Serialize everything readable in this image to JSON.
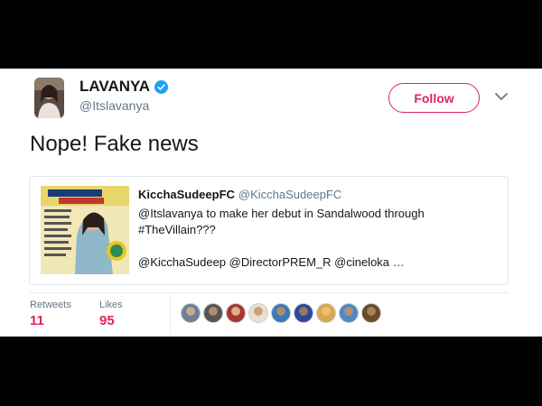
{
  "tweet": {
    "author": {
      "name": "LAVANYA",
      "handle": "@Itslavanya",
      "verified": true
    },
    "follow_label": "Follow",
    "text": "Nope! Fake news",
    "quote": {
      "author_name": "KicchaSudeepFC",
      "author_handle": "@KicchaSudeepFC",
      "line1": "@Itslavanya to make her debut in Sandalwood through",
      "line2": "#TheVillain???",
      "line3": "@KicchaSudeep @DirectorPREM_R @cineloka …"
    },
    "stats": {
      "retweets_label": "Retweets",
      "retweets": "11",
      "likes_label": "Likes",
      "likes": "95"
    }
  },
  "colors": {
    "accent": "#e0245e",
    "verified": "#1da1f2",
    "muted": "#657786"
  },
  "icons": [
    "verified-badge-icon",
    "chevron-down-icon"
  ]
}
